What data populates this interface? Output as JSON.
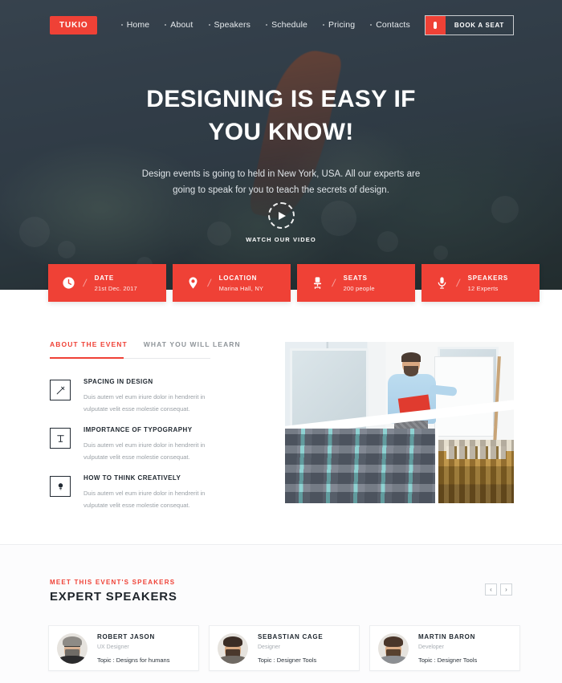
{
  "brand": {
    "logo_text": "TUKIO",
    "accent_color": "#ef4136",
    "dark_color": "#3a4550"
  },
  "nav": {
    "items": [
      {
        "label": "Home"
      },
      {
        "label": "About"
      },
      {
        "label": "Speakers"
      },
      {
        "label": "Schedule"
      },
      {
        "label": "Pricing"
      },
      {
        "label": "Contacts"
      }
    ],
    "cta": {
      "label": "BOOK A SEAT",
      "icon": "ticket-icon"
    }
  },
  "hero": {
    "title_line1": "DESIGNING IS EASY IF",
    "title_line2": "YOU KNOW!",
    "subtitle": "Design events is going to held in New York, USA. All our experts are going to speak for you to teach the secrets of design.",
    "watch_label": "WATCH OUR VIDEO",
    "play_icon": "play-icon"
  },
  "info_cards": [
    {
      "icon": "clock-icon",
      "title": "DATE",
      "value": "21st Dec. 2017"
    },
    {
      "icon": "location-icon",
      "title": "LOCATION",
      "value": "Marina Hall, NY"
    },
    {
      "icon": "chair-icon",
      "title": "SEATS",
      "value": "200 people"
    },
    {
      "icon": "microphone-icon",
      "title": "SPEAKERS",
      "value": "12 Experts"
    }
  ],
  "about": {
    "tabs": [
      {
        "label": "ABOUT THE EVENT",
        "active": true
      },
      {
        "label": "WHAT YOU WILL LEARN",
        "active": false
      }
    ],
    "features": [
      {
        "icon": "pencil-ruler-icon",
        "title": "SPACING IN DESIGN",
        "desc": "Duis autem vel eum iriure dolor in hendrerit in vulputate velit esse molestie consequat."
      },
      {
        "icon": "typography-icon",
        "title": "IMPORTANCE OF TYPOGRAPHY",
        "desc": "Duis autem vel eum iriure dolor in hendrerit in vulputate velit esse molestie consequat."
      },
      {
        "icon": "lightbulb-icon",
        "title": "HOW TO THINK CREATIVELY",
        "desc": "Duis autem vel eum iriure dolor in hendrerit in vulputate velit esse molestie consequat."
      }
    ]
  },
  "speakers": {
    "eyebrow": "MEET THIS EVENT'S SPEAKERS",
    "title": "EXPERT SPEAKERS",
    "prev_label": "‹",
    "next_label": "›",
    "cards": [
      {
        "name": "ROBERT JASON",
        "role": "UX Designer",
        "topic": "Topic : Designs for humans"
      },
      {
        "name": "SEBASTIAN CAGE",
        "role": "Designer",
        "topic": "Topic : Designer Tools"
      },
      {
        "name": "MARTIN BARON",
        "role": "Developer",
        "topic": "Topic : Designer Tools"
      }
    ]
  }
}
